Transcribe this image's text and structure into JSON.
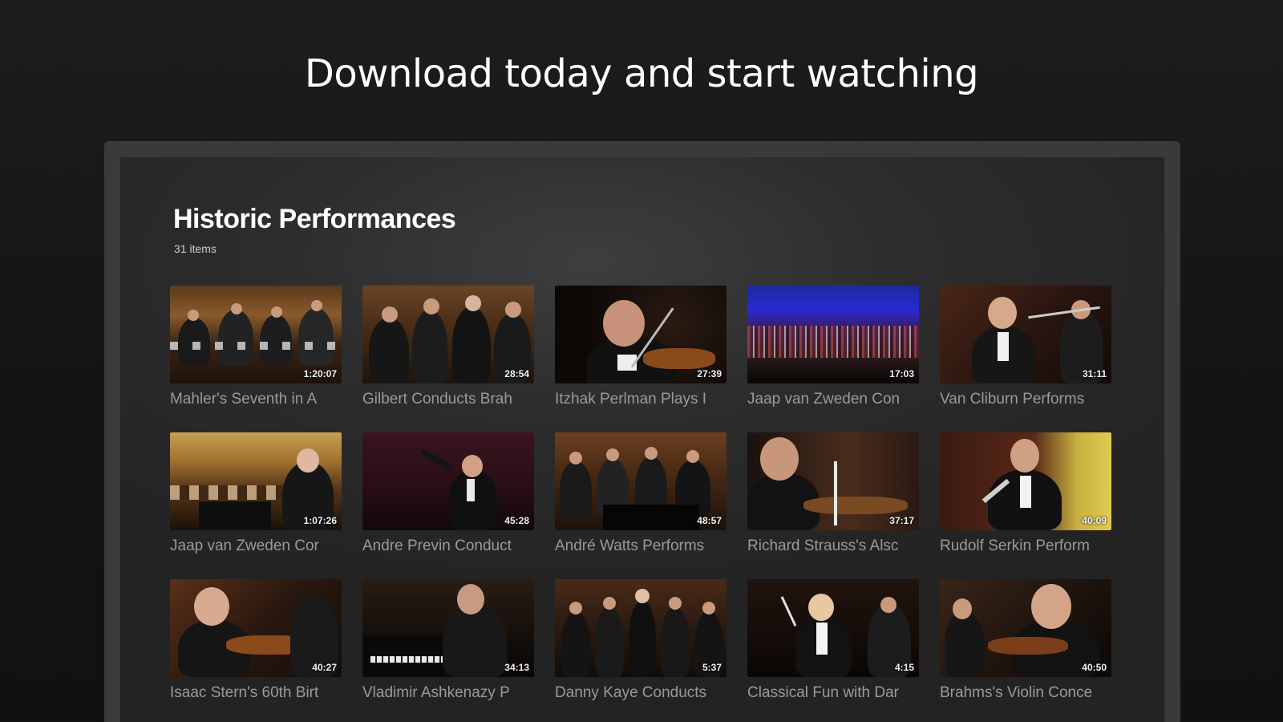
{
  "headline": "Download today and start watching",
  "section": {
    "title": "Historic Performances",
    "count": "31 items"
  },
  "tiles": [
    {
      "title": "Mahler's Seventh in A",
      "duration": "1:20:07",
      "thumb": "orchestra-wide"
    },
    {
      "title": "Gilbert Conducts Brah",
      "duration": "28:54",
      "thumb": "orchestra-close"
    },
    {
      "title": "Itzhak Perlman Plays I",
      "duration": "27:39",
      "thumb": "violinist-portrait"
    },
    {
      "title": "Jaap van Zweden Con",
      "duration": "17:03",
      "thumb": "stage-blue"
    },
    {
      "title": "Van Cliburn Performs",
      "duration": "31:11",
      "thumb": "orchestra-conductor"
    },
    {
      "title": "Jaap van Zweden Cor",
      "duration": "1:07:26",
      "thumb": "hall-conductor"
    },
    {
      "title": "Andre Previn Conduct",
      "duration": "45:28",
      "thumb": "conductor-dark"
    },
    {
      "title": "André Watts Performs",
      "duration": "48:57",
      "thumb": "pianist-orchestra"
    },
    {
      "title": "Richard Strauss's Alsc",
      "duration": "37:17",
      "thumb": "violinist-close"
    },
    {
      "title": "Rudolf Serkin Perform",
      "duration": "40:09",
      "thumb": "conductor-gold"
    },
    {
      "title": "Isaac Stern's 60th Birt",
      "duration": "40:27",
      "thumb": "violinist-elder"
    },
    {
      "title": "Vladimir Ashkenazy P",
      "duration": "34:13",
      "thumb": "pianist-dark"
    },
    {
      "title": "Danny Kaye Conducts",
      "duration": "5:37",
      "thumb": "orchestra-dark"
    },
    {
      "title": "Classical Fun with Dar",
      "duration": "4:15",
      "thumb": "conductor-white"
    },
    {
      "title": "Brahms's Violin Conce",
      "duration": "40:50",
      "thumb": "violinist-passion"
    }
  ]
}
